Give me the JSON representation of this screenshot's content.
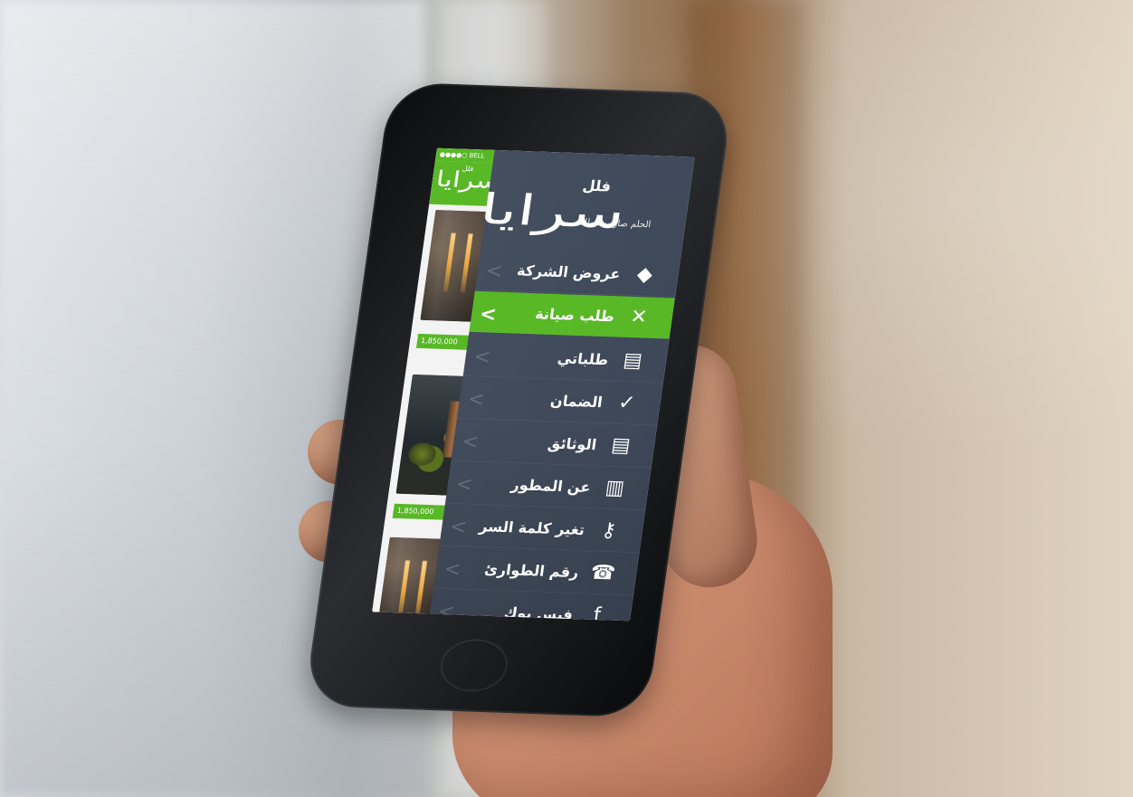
{
  "status": {
    "carrier": "●●●●○ BELL"
  },
  "header": {
    "mini_logo_small": "فلل",
    "mini_logo": "سرايا"
  },
  "listings": [
    {
      "price": "1,850,000"
    },
    {
      "price": "1,850,000"
    },
    {
      "price": ""
    }
  ],
  "drawer": {
    "brand_small": "فلل",
    "brand_main": "سرايا",
    "brand_slogan": "الحلم صار بمتناولك",
    "accent_color": "#58b826",
    "items": [
      {
        "label": "عروض الشركة",
        "icon": "tag-icon",
        "glyph": "◆"
      },
      {
        "label": "طلب صيانة",
        "icon": "maintenance-icon",
        "glyph": "✕"
      },
      {
        "label": "طلباتي",
        "icon": "requests-icon",
        "glyph": "▤"
      },
      {
        "label": "الضمان",
        "icon": "warranty-icon",
        "glyph": "✓"
      },
      {
        "label": "الوثائق",
        "icon": "documents-icon",
        "glyph": "▤"
      },
      {
        "label": "عن المطور",
        "icon": "developer-icon",
        "glyph": "▥"
      },
      {
        "label": "تغير كلمة السر",
        "icon": "key-icon",
        "glyph": "⚷"
      },
      {
        "label": "رقم الطوارئ",
        "icon": "phone-icon",
        "glyph": "☎"
      },
      {
        "label": "فيس بوك",
        "icon": "facebook-icon",
        "glyph": "f"
      }
    ],
    "chevron": "<"
  }
}
